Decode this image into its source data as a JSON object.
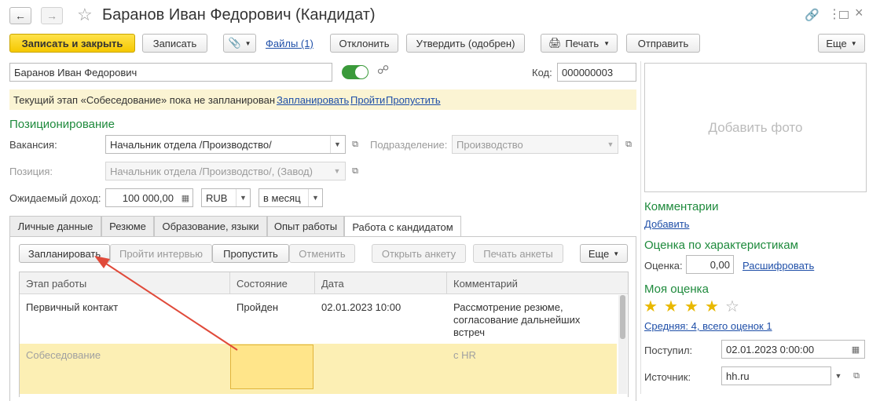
{
  "window": {
    "title": "Баранов Иван Федорович (Кандидат)",
    "back_icon": "arrow-left-icon",
    "forward_icon": "arrow-right-icon",
    "favorite_icon": "star-outline-icon"
  },
  "toolbar": {
    "save_close": "Записать и закрыть",
    "save": "Записать",
    "files": "Файлы (1)",
    "reject": "Отклонить",
    "approve": "Утвердить (одобрен)",
    "print": "Печать",
    "send": "Отправить",
    "more": "Еще"
  },
  "candidate": {
    "name": "Баранов Иван Федорович",
    "code_label": "Код:",
    "code": "000000003"
  },
  "notice": {
    "text": "Текущий этап «Собеседование» пока не запланирован",
    "plan_link": "Запланировать",
    "pass_link": "Пройти",
    "skip_link": "Пропустить"
  },
  "positioning": {
    "title": "Позиционирование",
    "vacancy_label": "Вакансия:",
    "vacancy": "Начальник отдела /Производство/",
    "department_label": "Подразделение:",
    "department": "Производство",
    "position_label": "Позиция:",
    "position": "Начальник отдела /Производство/, (Завод)",
    "income_label": "Ожидаемый доход:",
    "income": "100 000,00",
    "currency": "RUB",
    "period": "в месяц"
  },
  "tabs": [
    {
      "label": "Личные данные"
    },
    {
      "label": "Резюме"
    },
    {
      "label": "Образование, языки"
    },
    {
      "label": "Опыт работы"
    },
    {
      "label": "Работа с кандидатом"
    }
  ],
  "work_toolbar": {
    "plan": "Запланировать",
    "interview": "Пройти интервью",
    "skip": "Пропустить",
    "cancel": "Отменить",
    "open_form": "Открыть анкету",
    "print_forms": "Печать анкеты",
    "more": "Еще"
  },
  "table": {
    "headers": [
      "Этап работы",
      "Состояние",
      "Дата",
      "Комментарий"
    ],
    "rows": [
      {
        "stage": "Первичный контакт",
        "state": "Пройден",
        "date": "02.01.2023 10:00",
        "comment": "Рассмотрение резюме, согласование дальнейших встреч"
      },
      {
        "stage": "Собеседование",
        "state": "",
        "date": "",
        "comment": "с HR"
      }
    ]
  },
  "right_panel": {
    "add_photo": "Добавить фото",
    "comments_title": "Комментарии",
    "add_comment": "Добавить",
    "rating_title": "Оценка по характеристикам",
    "rating_label": "Оценка:",
    "rating_value": "0,00",
    "decode_link": "Расшифровать",
    "my_rating_title": "Моя оценка",
    "my_rating_stars": 4,
    "my_rating_max": 5,
    "average_link": "Средняя: 4, всего оценок 1",
    "received_label": "Поступил:",
    "received_value": "02.01.2023  0:00:00",
    "source_label": "Источник:",
    "source_value": "hh.ru"
  },
  "colors": {
    "accent_green": "#1e8a3c",
    "link_blue": "#1f4fa8",
    "primary_yellow": "#f5c800",
    "notice_bg": "#fbf4d3",
    "selected_row_bg": "#fcefb4",
    "annotation_red": "#e04a3a"
  }
}
